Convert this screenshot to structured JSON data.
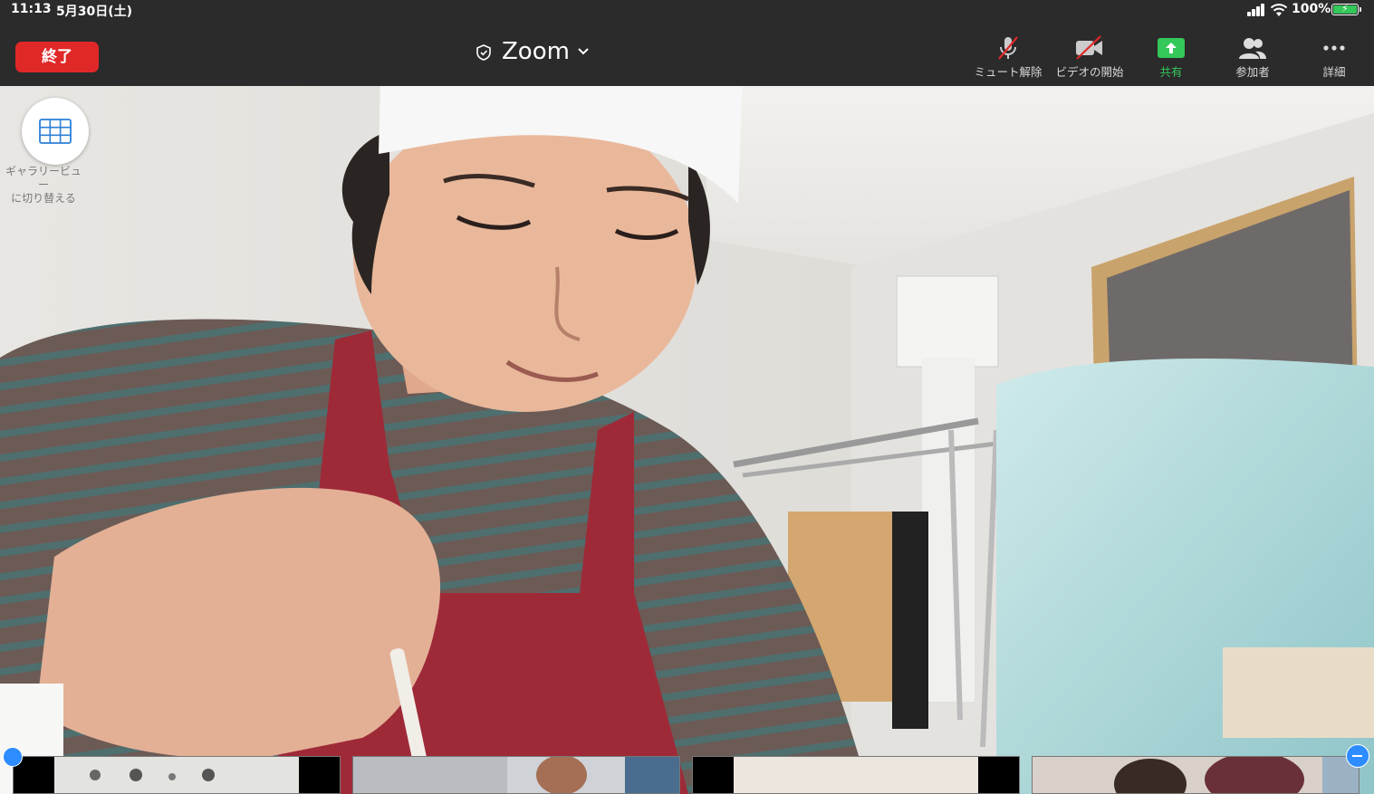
{
  "status_bar": {
    "time": "11:13",
    "date": "5月30日(土)",
    "battery_percent": "100%",
    "icons": [
      "signal-icon",
      "wifi-icon",
      "battery-charging-icon"
    ]
  },
  "toolbar": {
    "end_label": "終了",
    "title": "Zoom",
    "buttons": [
      {
        "label": "ミュート解除",
        "icon": "microphone-muted-icon"
      },
      {
        "label": "ビデオの開始",
        "icon": "video-off-icon"
      },
      {
        "label": "共有",
        "icon": "share-screen-icon"
      },
      {
        "label": "参加者",
        "icon": "participants-icon"
      },
      {
        "label": "詳細",
        "icon": "more-icon"
      }
    ],
    "colors": {
      "end": "#e02828",
      "share": "#34c759",
      "bar": "#2b2b2b"
    }
  },
  "gallery_toggle": {
    "label_line1": "ギャラリービュー",
    "label_line2": "に切り替える",
    "icon": "grid-icon"
  },
  "main_video": {
    "description_icon": "video-feed"
  },
  "thumbnails": {
    "count": 4
  }
}
